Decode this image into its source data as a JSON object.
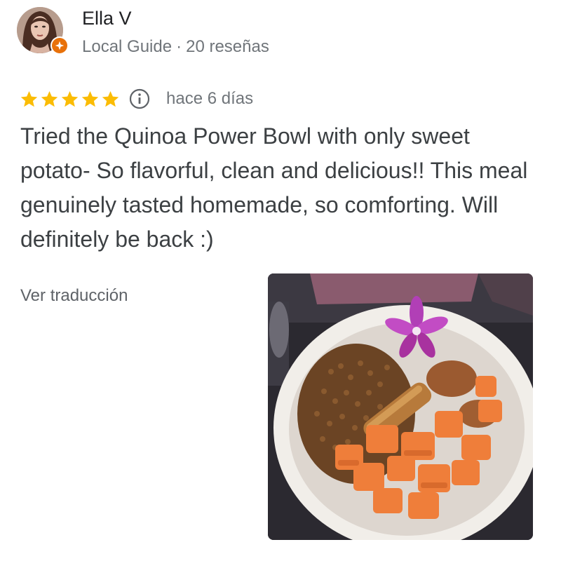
{
  "reviewer": {
    "name": "Ella V",
    "badge_icon": "local-guide-badge-icon",
    "role": "Local Guide",
    "separator": "·",
    "review_count": "20 reseñas"
  },
  "review": {
    "rating": 5,
    "rating_max": 5,
    "star_color": "#fbbc04",
    "info_icon": "info-icon",
    "date": "hace 6 días",
    "text": "Tried the Quinoa Power Bowl with only sweet potato- So flavorful, clean and delicious!! This meal genuinely tasted homemade, so comforting. Will definitely be back :)",
    "translate_label": "Ver traducción"
  },
  "colors": {
    "text_primary": "#202124",
    "text_secondary": "#70757a",
    "badge_orange": "#e8710a"
  }
}
